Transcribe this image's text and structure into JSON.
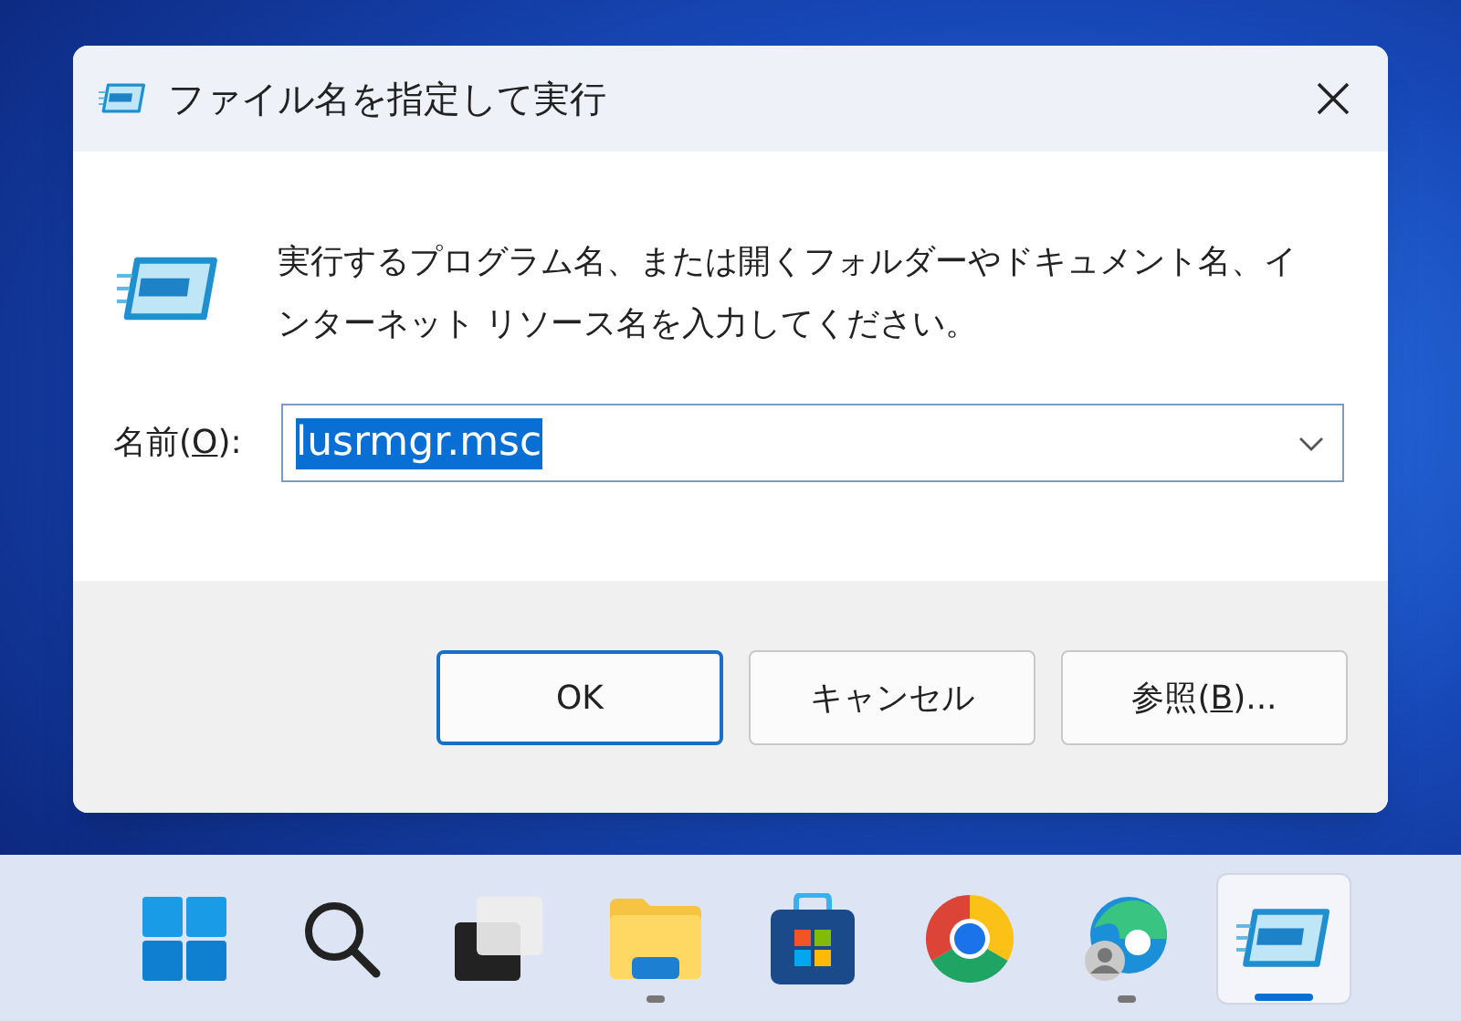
{
  "window": {
    "title": "ファイル名を指定して実行"
  },
  "message": "実行するプログラム名、または開くフォルダーやドキュメント名、インターネット リソース名を入力してください。",
  "name_field": {
    "label_before": "名前(",
    "mnemonic": "O",
    "label_after": "):",
    "value": "lusrmgr.msc",
    "value_selected": true
  },
  "buttons": [
    {
      "kind": "default",
      "label_before": "OK"
    },
    {
      "kind": "normal",
      "label_before": "キャンセル"
    },
    {
      "kind": "normal",
      "label_before": "参照(",
      "mnemonic": "B",
      "label_after": ")..."
    }
  ],
  "taskbar": [
    {
      "kind": "start",
      "running": false,
      "selected": false
    },
    {
      "kind": "search",
      "running": false,
      "selected": false
    },
    {
      "kind": "taskview",
      "running": false,
      "selected": false
    },
    {
      "kind": "explorer",
      "running": true,
      "selected": false
    },
    {
      "kind": "store",
      "running": false,
      "selected": false
    },
    {
      "kind": "chrome",
      "running": false,
      "selected": false
    },
    {
      "kind": "edge",
      "running": true,
      "selected": false
    },
    {
      "kind": "run",
      "running": true,
      "selected": true
    }
  ]
}
